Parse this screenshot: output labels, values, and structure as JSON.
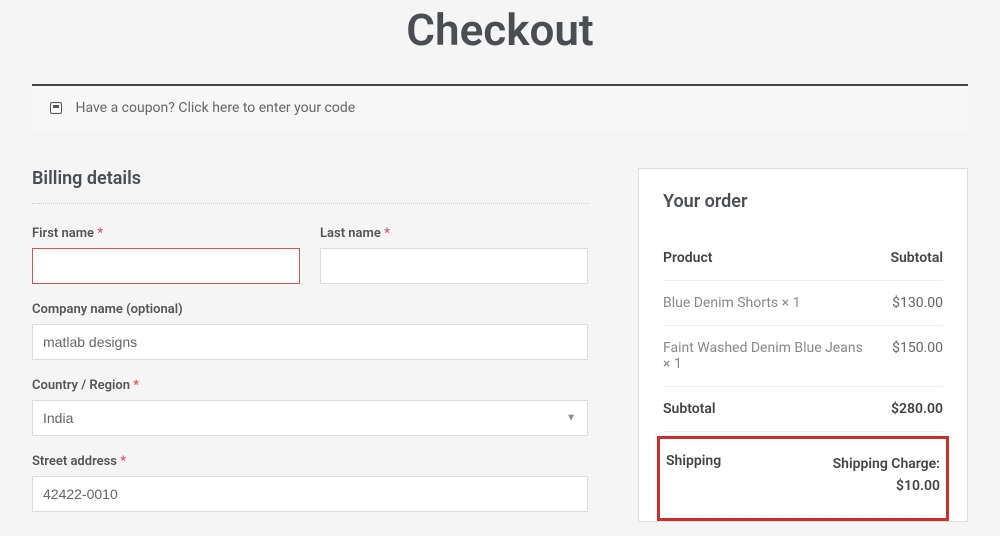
{
  "page": {
    "title": "Checkout"
  },
  "coupon": {
    "prompt": "Have a coupon?",
    "link": "Click here to enter your code"
  },
  "billing": {
    "heading": "Billing details",
    "first_name": {
      "label": "First name",
      "value": ""
    },
    "last_name": {
      "label": "Last name",
      "value": ""
    },
    "company": {
      "label": "Company name (optional)",
      "value": "matlab designs"
    },
    "country": {
      "label": "Country / Region",
      "value": "India"
    },
    "street": {
      "label": "Street address",
      "value": "42422-0010"
    }
  },
  "order": {
    "heading": "Your order",
    "product_header": "Product",
    "subtotal_header": "Subtotal",
    "items": [
      {
        "name": "Blue Denim Shorts",
        "qty": "× 1",
        "price": "$130.00"
      },
      {
        "name": "Faint Washed Denim Blue Jeans",
        "qty": "× 1",
        "price": "$150.00"
      }
    ],
    "subtotal": {
      "label": "Subtotal",
      "value": "$280.00"
    },
    "shipping": {
      "label": "Shipping",
      "charge_label": "Shipping Charge:",
      "value": "$10.00"
    }
  }
}
